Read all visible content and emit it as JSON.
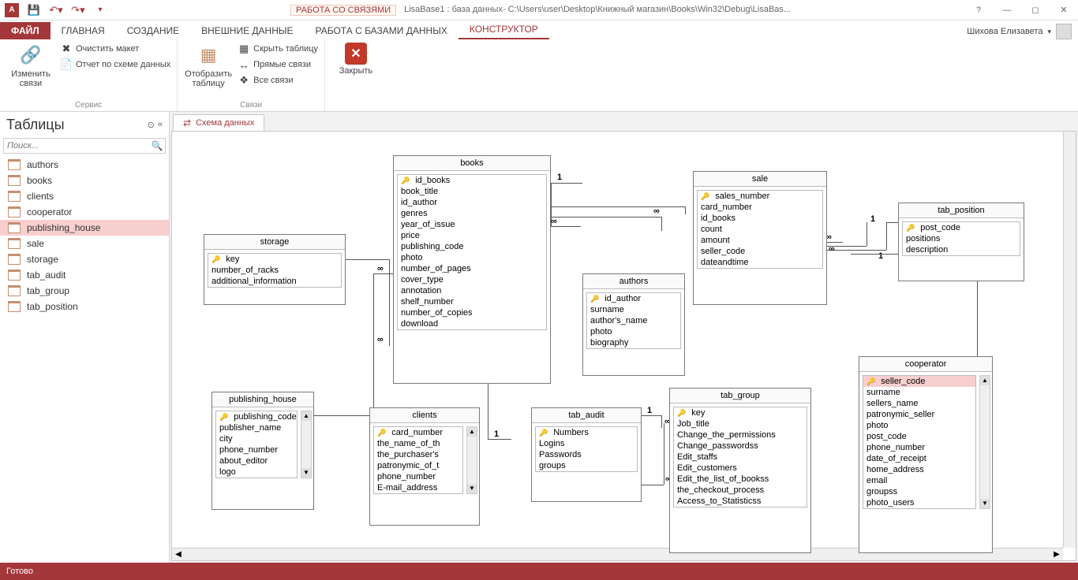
{
  "title": {
    "tools_context": "РАБОТА СО СВЯЗЯМИ",
    "caption": "LisaBase1 : база данных- C:\\Users\\user\\Desktop\\Книжный магазин\\Books\\Win32\\Debug\\LisaBas...",
    "user": "Шихова Елизавета"
  },
  "tabs": {
    "file": "ФАЙЛ",
    "home": "ГЛАВНАЯ",
    "create": "СОЗДАНИЕ",
    "external": "ВНЕШНИЕ ДАННЫЕ",
    "dbtools": "РАБОТА С БАЗАМИ ДАННЫХ",
    "designer": "КОНСТРУКТОР"
  },
  "ribbon": {
    "edit_rel": "Изменить связи",
    "clear_layout": "Очистить макет",
    "rel_report": "Отчет по схеме данных",
    "group1": "Сервис",
    "show_table": "Отобразить таблицу",
    "hide_table": "Скрыть таблицу",
    "direct_rel": "Прямые связи",
    "all_rel": "Все связи",
    "group2": "Связи",
    "close": "Закрыть"
  },
  "nav": {
    "header": "Таблицы",
    "search_placeholder": "Поиск...",
    "items": [
      "authors",
      "books",
      "clients",
      "cooperator",
      "publishing_house",
      "sale",
      "storage",
      "tab_audit",
      "tab_group",
      "tab_position"
    ],
    "selected": "publishing_house"
  },
  "doctab": "Схема данных",
  "entities": {
    "storage": {
      "title": "storage",
      "fields": [
        {
          "n": "key",
          "k": true
        },
        {
          "n": "number_of_racks"
        },
        {
          "n": "additional_information"
        }
      ]
    },
    "books": {
      "title": "books",
      "fields": [
        {
          "n": "id_books",
          "k": true
        },
        {
          "n": "book_title"
        },
        {
          "n": "id_author"
        },
        {
          "n": "genres"
        },
        {
          "n": "year_of_issue"
        },
        {
          "n": "price"
        },
        {
          "n": "publishing_code"
        },
        {
          "n": "photo"
        },
        {
          "n": "number_of_pages"
        },
        {
          "n": "cover_type"
        },
        {
          "n": "annotation"
        },
        {
          "n": "shelf_number"
        },
        {
          "n": "number_of_copies"
        },
        {
          "n": "download"
        }
      ]
    },
    "authors": {
      "title": "authors",
      "fields": [
        {
          "n": "id_author",
          "k": true
        },
        {
          "n": "surname"
        },
        {
          "n": "author's_name"
        },
        {
          "n": "photo"
        },
        {
          "n": "biography"
        }
      ]
    },
    "sale": {
      "title": "sale",
      "fields": [
        {
          "n": "sales_number",
          "k": true
        },
        {
          "n": "card_number"
        },
        {
          "n": "id_books"
        },
        {
          "n": "count"
        },
        {
          "n": "amount"
        },
        {
          "n": "seller_code"
        },
        {
          "n": "dateandtime"
        }
      ]
    },
    "tab_position": {
      "title": "tab_position",
      "fields": [
        {
          "n": "post_code",
          "k": true
        },
        {
          "n": "positions"
        },
        {
          "n": "description"
        }
      ]
    },
    "publishing_house": {
      "title": "publishing_house",
      "fields": [
        {
          "n": "publishing_code",
          "k": true
        },
        {
          "n": "publisher_name"
        },
        {
          "n": "city"
        },
        {
          "n": "phone_number"
        },
        {
          "n": "about_editor"
        },
        {
          "n": "logo"
        }
      ]
    },
    "clients": {
      "title": "clients",
      "fields": [
        {
          "n": "card_number",
          "k": true
        },
        {
          "n": "the_name_of_th"
        },
        {
          "n": "the_purchaser's"
        },
        {
          "n": "patronymic_of_t"
        },
        {
          "n": "phone_number"
        },
        {
          "n": "E-mail_address"
        }
      ]
    },
    "tab_audit": {
      "title": "tab_audit",
      "fields": [
        {
          "n": "Numbers",
          "k": true
        },
        {
          "n": "Logins"
        },
        {
          "n": "Passwords"
        },
        {
          "n": "groups"
        }
      ]
    },
    "tab_group": {
      "title": "tab_group",
      "fields": [
        {
          "n": "key",
          "k": true
        },
        {
          "n": "Job_title"
        },
        {
          "n": "Change_the_permissions"
        },
        {
          "n": "Change_passwordss"
        },
        {
          "n": "Edit_staffs"
        },
        {
          "n": "Edit_customers"
        },
        {
          "n": "Edit_the_list_of_bookss"
        },
        {
          "n": "the_checkout_process"
        },
        {
          "n": "Access_to_Statisticss"
        }
      ]
    },
    "cooperator": {
      "title": "cooperator",
      "fields": [
        {
          "n": "seller_code",
          "k": true,
          "sel": true
        },
        {
          "n": "surname"
        },
        {
          "n": "sellers_name"
        },
        {
          "n": "patronymic_seller"
        },
        {
          "n": "photo"
        },
        {
          "n": "post_code"
        },
        {
          "n": "phone_number"
        },
        {
          "n": "date_of_receipt"
        },
        {
          "n": "home_address"
        },
        {
          "n": "email"
        },
        {
          "n": "groupss"
        },
        {
          "n": "photo_users"
        }
      ]
    }
  },
  "rel": {
    "one": "1",
    "many": "∞"
  },
  "status": "Готово"
}
